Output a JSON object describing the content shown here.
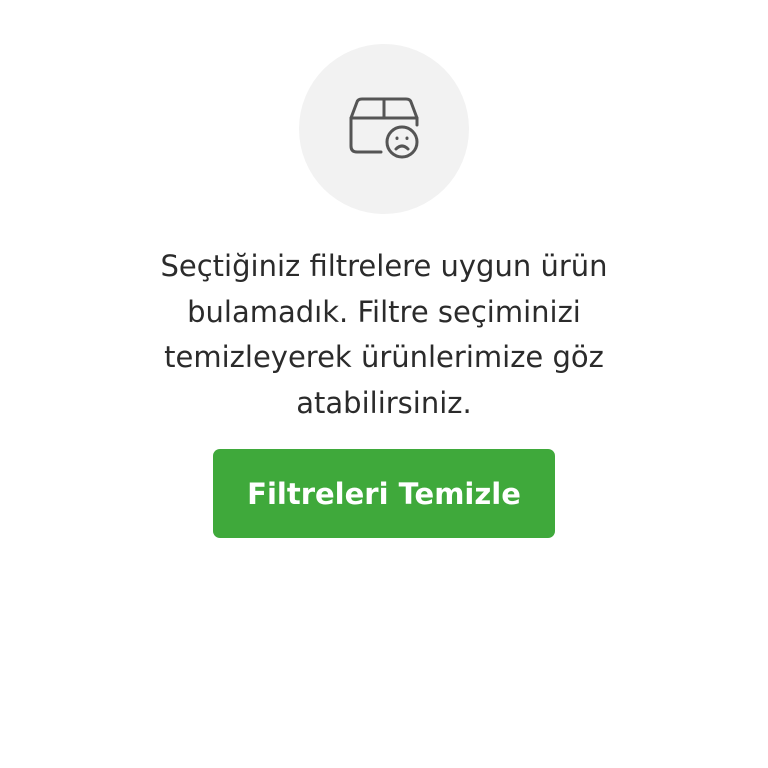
{
  "empty_state": {
    "icon": "box-sad-face-icon",
    "message": "Seçtiğiniz filtrelere uygun ürün bulamadık. Filtre seçiminizi temizleyerek ürünlerimize göz atabilirsiniz.",
    "button_label": "Filtreleri Temizle"
  },
  "colors": {
    "button_bg": "#3fa93b",
    "button_text": "#ffffff",
    "icon_circle_bg": "#f2f2f2",
    "icon_stroke": "#555555",
    "message_text": "#2b2b2b"
  }
}
